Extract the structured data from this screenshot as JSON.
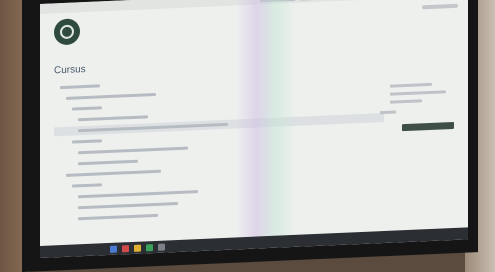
{
  "app": {
    "title": "Cursus"
  },
  "tree": {
    "items": [
      {
        "label": "",
        "indent": 0,
        "highlight": false
      },
      {
        "label": "",
        "indent": 1,
        "highlight": false
      },
      {
        "label": "",
        "indent": 2,
        "highlight": false
      },
      {
        "label": "",
        "indent": 3,
        "highlight": false
      },
      {
        "label": "",
        "indent": 3,
        "highlight": true
      },
      {
        "label": "",
        "indent": 2,
        "highlight": false
      },
      {
        "label": "",
        "indent": 3,
        "highlight": false
      },
      {
        "label": "",
        "indent": 3,
        "highlight": false
      },
      {
        "label": "",
        "indent": 1,
        "highlight": false
      },
      {
        "label": "",
        "indent": 2,
        "highlight": false
      },
      {
        "label": "",
        "indent": 3,
        "highlight": false
      },
      {
        "label": "",
        "indent": 3,
        "highlight": false
      },
      {
        "label": "",
        "indent": 3,
        "highlight": false
      }
    ]
  },
  "colors": {
    "accent": "#3e4f47",
    "logo": "#2f4a3f"
  },
  "icons": {
    "logo": "logo-icon"
  }
}
